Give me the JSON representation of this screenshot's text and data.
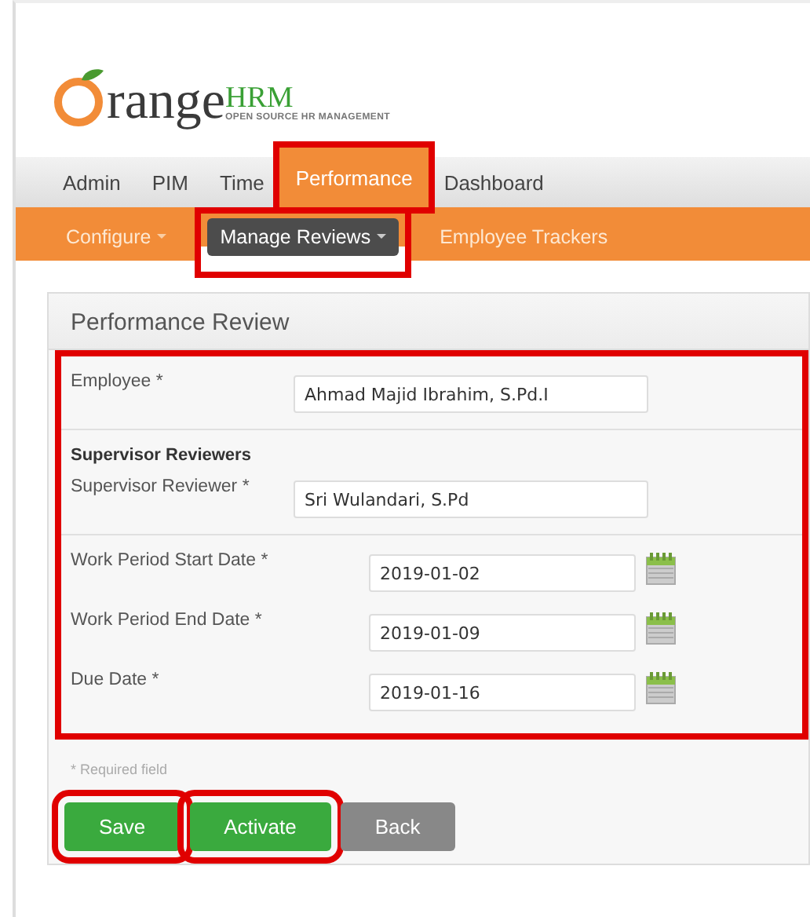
{
  "logo": {
    "wordmark": "range",
    "accent": "HRM",
    "tagline": "OPEN SOURCE HR MANAGEMENT"
  },
  "main_menu": [
    {
      "label": "Admin",
      "selected": false,
      "highlighted": false
    },
    {
      "label": "PIM",
      "selected": false,
      "highlighted": false
    },
    {
      "label": "Time",
      "selected": false,
      "highlighted": false
    },
    {
      "label": "Performance",
      "selected": true,
      "highlighted": true
    },
    {
      "label": "Dashboard",
      "selected": false,
      "highlighted": false
    }
  ],
  "sub_menu": [
    {
      "label": "Configure",
      "dropdown": true,
      "selected": false,
      "highlighted": false
    },
    {
      "label": "Manage Reviews",
      "dropdown": true,
      "selected": true,
      "highlighted": true
    },
    {
      "label": "Employee Trackers",
      "dropdown": false,
      "selected": false,
      "highlighted": false
    }
  ],
  "panel": {
    "title": "Performance Review",
    "form_highlighted": true,
    "sections": [
      {
        "fields": [
          {
            "label": "Employee",
            "required": "*",
            "value": "Ahmad Majid Ibrahim, S.Pd.I",
            "kind": "text"
          }
        ]
      },
      {
        "heading": "Supervisor Reviewers",
        "fields": [
          {
            "label": "Supervisor Reviewer",
            "required": "*",
            "value": "Sri Wulandari, S.Pd",
            "kind": "text"
          }
        ]
      },
      {
        "fields": [
          {
            "label": "Work Period Start Date",
            "required": "*",
            "value": "2019-01-02",
            "kind": "date"
          },
          {
            "label": "Work Period End Date",
            "required": "*",
            "value": "2019-01-09",
            "kind": "date"
          },
          {
            "label": "Due Date",
            "required": "*",
            "value": "2019-01-16",
            "kind": "date"
          }
        ]
      }
    ],
    "required_note": "* Required field",
    "buttons": [
      {
        "label": "Save",
        "kind": "primary",
        "highlighted": true
      },
      {
        "label": "Activate",
        "kind": "primary",
        "highlighted": true
      },
      {
        "label": "Back",
        "kind": "secondary",
        "highlighted": false
      }
    ]
  }
}
